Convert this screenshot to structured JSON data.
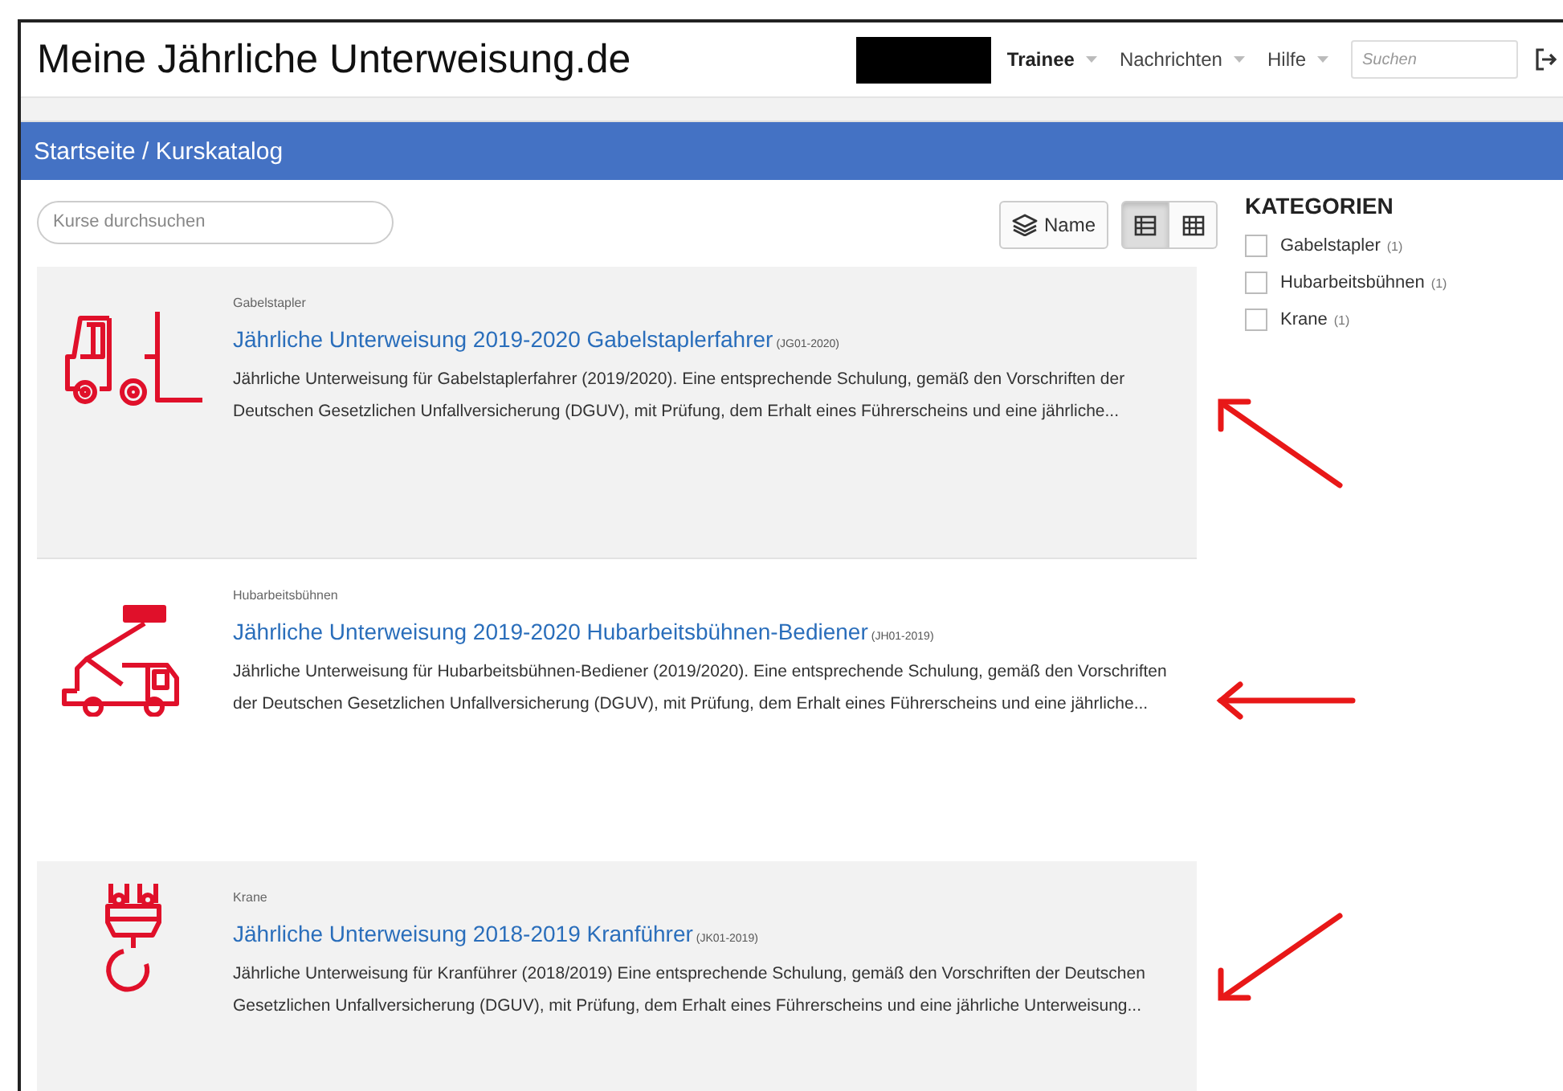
{
  "header": {
    "site_title": "Meine Jährliche Unterweisung.de",
    "nav": [
      {
        "label": "Trainee",
        "active": true
      },
      {
        "label": "Nachrichten",
        "active": false
      },
      {
        "label": "Hilfe",
        "active": false
      }
    ],
    "search": {
      "placeholder": "Suchen"
    }
  },
  "breadcrumb": "Startseite / Kurskatalog",
  "toolbar": {
    "search": {
      "placeholder": "Kurse durchsuchen"
    },
    "sort_label": "Name",
    "views": [
      {
        "kind": "list",
        "selected": true
      },
      {
        "kind": "grid",
        "selected": false
      }
    ]
  },
  "courses": [
    {
      "kind": "forklift",
      "category": "Gabelstapler",
      "title": "Jährliche Unterweisung 2019-2020 Gabelstaplerfahrer",
      "code": "(JG01-2020)",
      "description": "Jährliche Unterweisung für Gabelstaplerfahrer (2019/2020). Eine entsprechende Schulung, gemäß den Vorschriften der Deutschen Gesetzlichen Unfallversicherung (DGUV), mit Prüfung, dem Erhalt eines Führerscheins und eine jährliche..."
    },
    {
      "kind": "lift",
      "category": "Hubarbeitsbühnen",
      "title": "Jährliche Unterweisung 2019-2020 Hubarbeitsbühnen-Bediener",
      "code": "(JH01-2019)",
      "description": "Jährliche Unterweisung für Hubarbeitsbühnen-Bediener (2019/2020). Eine entsprechende Schulung, gemäß den Vorschriften der Deutschen Gesetzlichen Unfallversicherung (DGUV), mit Prüfung, dem Erhalt eines Führerscheins und eine jährliche..."
    },
    {
      "kind": "crane",
      "category": "Krane",
      "title": "Jährliche Unterweisung 2018-2019 Kranführer",
      "code": "(JK01-2019)",
      "description": "Jährliche Unterweisung für Kranführer (2018/2019) Eine entsprechende Schulung, gemäß den Vorschriften der Deutschen Gesetzlichen Unfallversicherung (DGUV), mit Prüfung, dem Erhalt eines Führerscheins und eine jährliche Unterweisung..."
    }
  ],
  "categories": {
    "heading": "KATEGORIEN",
    "items": [
      {
        "label": "Gabelstapler",
        "count": "(1)",
        "checked": false
      },
      {
        "label": "Hubarbeitsbühnen",
        "count": "(1)",
        "checked": false
      },
      {
        "label": "Krane",
        "count": "(1)",
        "checked": false
      }
    ]
  }
}
